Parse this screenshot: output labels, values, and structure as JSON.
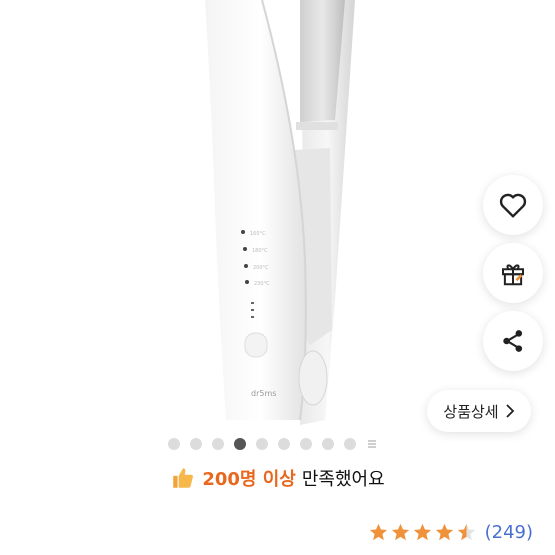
{
  "product": {
    "brand_mark": "dr5ms",
    "temp_labels": [
      "160°C",
      "180°C",
      "200°C",
      "230°C"
    ]
  },
  "actions": {
    "wishlist_icon": "heart-icon",
    "gift_icon": "gift-icon",
    "share_icon": "share-icon",
    "detail_label": "상품상세",
    "detail_icon": "chevron-right-icon"
  },
  "carousel": {
    "total_dots": 9,
    "active_index": 3
  },
  "satisfaction": {
    "icon": "thumbs-up-icon",
    "highlight": "200명 이상",
    "rest": "만족했어요"
  },
  "rating": {
    "stars": 4.5,
    "count_text": "(249)",
    "star_color": "#f0923a"
  }
}
